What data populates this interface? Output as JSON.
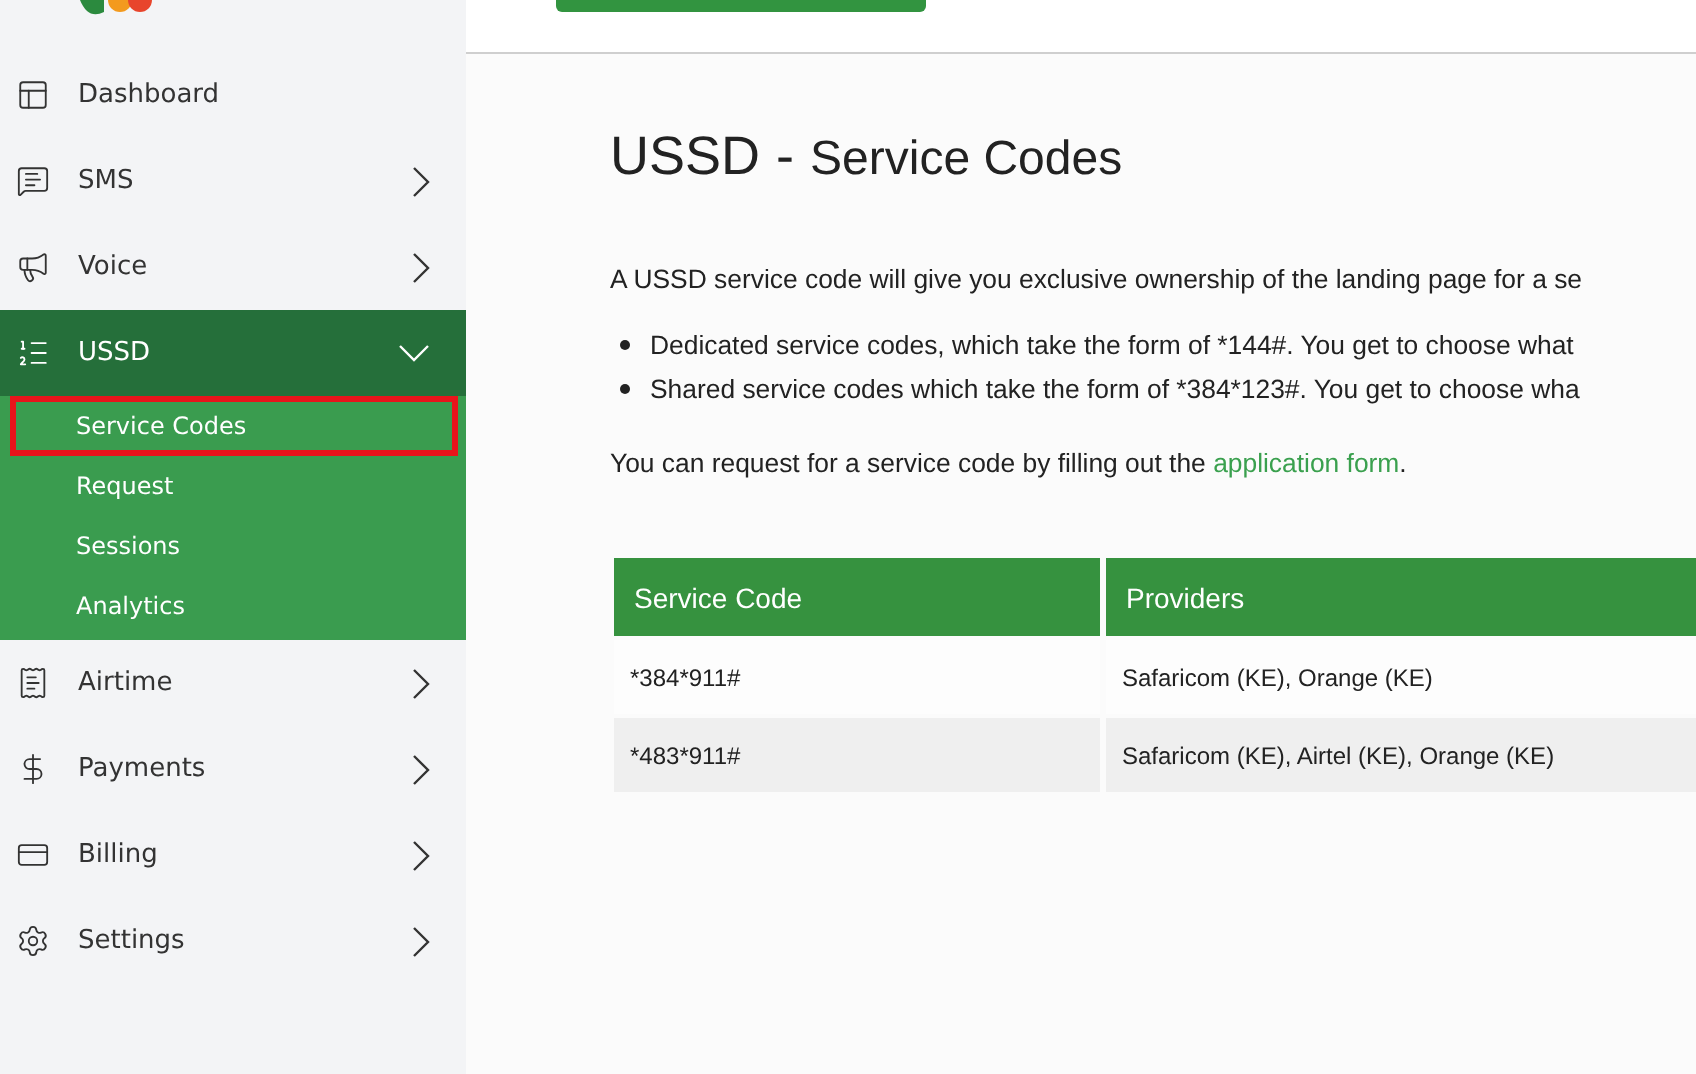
{
  "sidebar": {
    "items": [
      {
        "label": "Dashboard",
        "kind": "link",
        "expanded": false
      },
      {
        "label": "SMS",
        "kind": "group",
        "expanded": false
      },
      {
        "label": "Voice",
        "kind": "group",
        "expanded": false
      },
      {
        "label": "USSD",
        "kind": "group",
        "expanded": true,
        "children": [
          {
            "label": "Service Codes",
            "selected": true
          },
          {
            "label": "Request",
            "selected": false
          },
          {
            "label": "Sessions",
            "selected": false
          },
          {
            "label": "Analytics",
            "selected": false
          }
        ]
      },
      {
        "label": "Airtime",
        "kind": "group",
        "expanded": false
      },
      {
        "label": "Payments",
        "kind": "group",
        "expanded": false
      },
      {
        "label": "Billing",
        "kind": "group",
        "expanded": false
      },
      {
        "label": "Settings",
        "kind": "group",
        "expanded": false
      }
    ]
  },
  "page": {
    "title": "USSD",
    "subtitle": "Service Codes",
    "separator": "-",
    "intro": "A USSD service code will give you exclusive ownership of the landing page for a se",
    "bullets": [
      "Dedicated service codes, which take the form of *144#. You get to choose what",
      "Shared service codes which take the form of *384*123#. You get to choose wha"
    ],
    "request_text": "You can request for a service code by filling out the",
    "request_link": "application form",
    "request_end": "."
  },
  "table": {
    "columns": [
      "Service Code",
      "Providers"
    ],
    "rows": [
      [
        "*384*911#",
        "Safaricom (KE), Orange (KE)"
      ],
      [
        "*483*911#",
        "Safaricom (KE), Airtel (KE), Orange (KE)"
      ]
    ]
  }
}
